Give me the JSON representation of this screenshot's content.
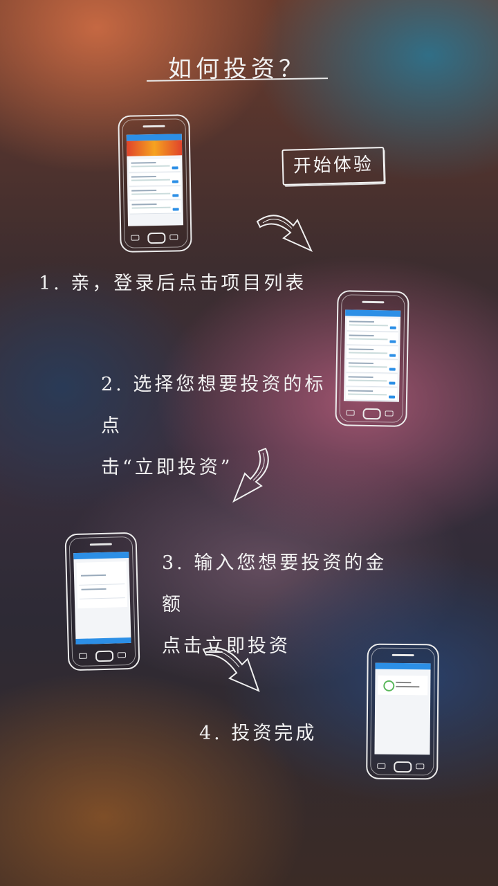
{
  "title": "如何投资？",
  "start_button": "开始体验",
  "steps": [
    {
      "line1": "1. 亲，登录后点击项目列表"
    },
    {
      "line1": "2. 选择您想要投资的标点",
      "line2": "击“立即投资”"
    },
    {
      "line1": "3. 输入您想要投资的金额",
      "line2": "点击立即投资"
    },
    {
      "line1": "4. 投资完成"
    }
  ],
  "colors": {
    "accent": "#2c8fe6",
    "text": "#f2f2f2",
    "success": "#5bb85c"
  },
  "icons": [
    "hand-drawn-phone-icon",
    "hand-drawn-arrow-icon",
    "checkmark-icon"
  ]
}
